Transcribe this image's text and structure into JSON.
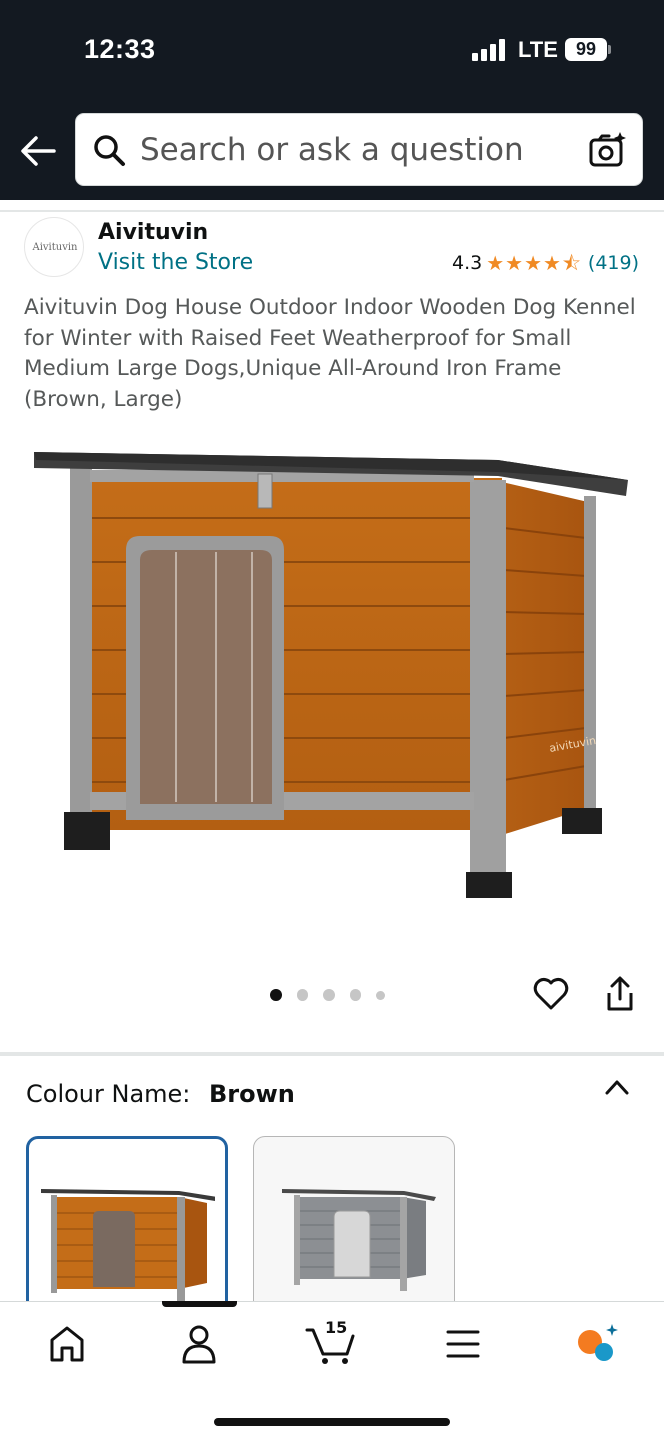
{
  "status_bar": {
    "time": "12:33",
    "network": "LTE",
    "battery": "99"
  },
  "header": {
    "search_placeholder": "Search or ask a question",
    "icons": [
      "back-arrow-icon",
      "search-icon",
      "camera-search-icon"
    ]
  },
  "product": {
    "brand_logo_text": "Aivituvin",
    "brand_name": "Aivituvin",
    "visit_store": "Visit the Store",
    "rating": "4.3",
    "stars_filled": 4.3,
    "review_count": "(419)",
    "title": "Aivituvin Dog House Outdoor Indoor Wooden Dog Kennel for Winter with Raised Feet Weatherproof for Small Medium Large Dogs,Unique All-Around Iron Frame (Brown, Large)",
    "image_count": 5,
    "active_image_index": 0
  },
  "colour": {
    "label": "Colour Name:",
    "value": "Brown",
    "options": [
      {
        "name": "Brown",
        "selected": true
      },
      {
        "name": "Grey",
        "selected": false
      }
    ]
  },
  "tabbar": {
    "items": [
      "home-icon",
      "account-icon",
      "cart-icon",
      "menu-icon",
      "rufus-assistant-icon"
    ],
    "active_index": 1,
    "cart_count": "15"
  },
  "colors": {
    "header_bg": "#131921",
    "link": "#007185",
    "star": "#f08a24",
    "selected_border": "#2162a1"
  }
}
